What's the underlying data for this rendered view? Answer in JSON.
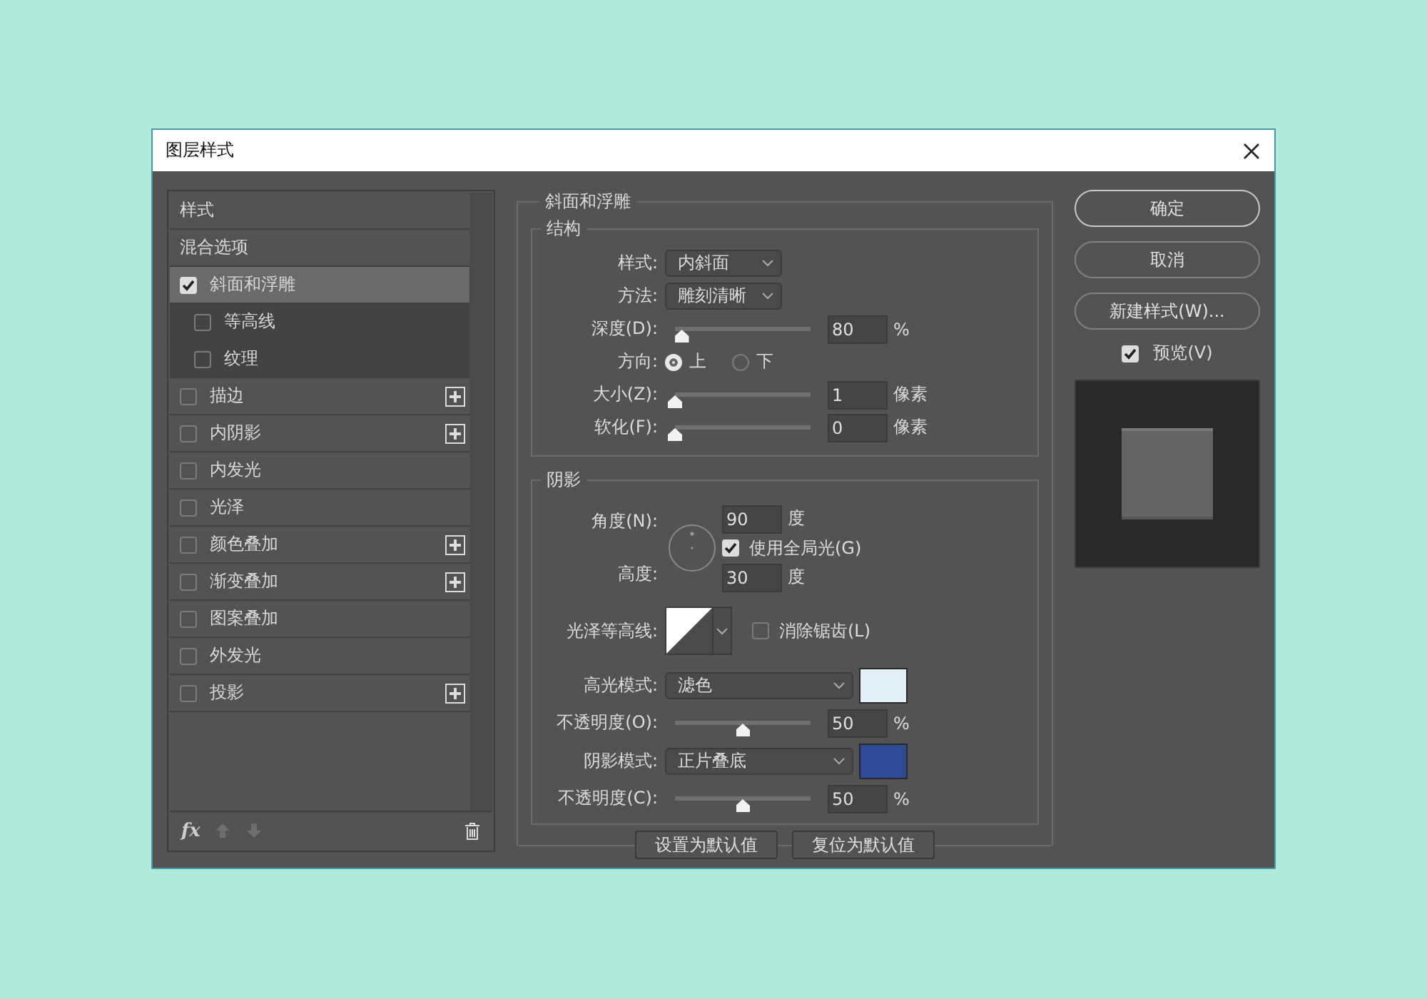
{
  "window": {
    "title": "图层样式"
  },
  "styles_list": [
    {
      "kind": "section",
      "label": "样式",
      "selected": false
    },
    {
      "kind": "section",
      "label": "混合选项",
      "selected": false
    },
    {
      "kind": "effect",
      "label": "斜面和浮雕",
      "checked": true,
      "selected": true,
      "addable": false,
      "children": [
        {
          "kind": "effect",
          "label": "等高线",
          "checked": false,
          "selected": false
        },
        {
          "kind": "effect",
          "label": "纹理",
          "checked": false,
          "selected": false
        }
      ]
    },
    {
      "kind": "effect",
      "label": "描边",
      "checked": false,
      "selected": false,
      "addable": true
    },
    {
      "kind": "effect",
      "label": "内阴影",
      "checked": false,
      "selected": false,
      "addable": true
    },
    {
      "kind": "effect",
      "label": "内发光",
      "checked": false,
      "selected": false,
      "addable": false
    },
    {
      "kind": "effect",
      "label": "光泽",
      "checked": false,
      "selected": false,
      "addable": false
    },
    {
      "kind": "effect",
      "label": "颜色叠加",
      "checked": false,
      "selected": false,
      "addable": true
    },
    {
      "kind": "effect",
      "label": "渐变叠加",
      "checked": false,
      "selected": false,
      "addable": true
    },
    {
      "kind": "effect",
      "label": "图案叠加",
      "checked": false,
      "selected": false,
      "addable": false
    },
    {
      "kind": "effect",
      "label": "外发光",
      "checked": false,
      "selected": false,
      "addable": false
    },
    {
      "kind": "effect",
      "label": "投影",
      "checked": false,
      "selected": false,
      "addable": true
    }
  ],
  "list_footer": {
    "effects_button": "fx"
  },
  "bevel": {
    "title": "斜面和浮雕",
    "structure": {
      "title": "结构",
      "style": {
        "label": "样式:",
        "value": "内斜面"
      },
      "technique": {
        "label": "方法:",
        "value": "雕刻清晰"
      },
      "depth": {
        "label": "深度(D):",
        "level": 0.05,
        "value": "80",
        "unit": "%"
      },
      "direction": {
        "label": "方向:",
        "options": [
          {
            "label": "上",
            "selected": true
          },
          {
            "label": "下",
            "selected": false
          }
        ]
      },
      "size": {
        "label": "大小(Z):",
        "level": 0,
        "value": "1",
        "unit": "像素"
      },
      "soften": {
        "label": "软化(F):",
        "level": 0,
        "value": "0",
        "unit": "像素"
      }
    },
    "shading": {
      "title": "阴影",
      "angle": {
        "label": "角度(N):",
        "value": "90",
        "unit": "度"
      },
      "global_light": {
        "label": "使用全局光(G)",
        "checked": true
      },
      "altitude": {
        "label": "高度:",
        "value": "30",
        "unit": "度"
      },
      "gloss_contour": {
        "label": "光泽等高线:"
      },
      "anti_alias": {
        "label": "消除锯齿(L)",
        "checked": false
      },
      "highlight_mode": {
        "label": "高光模式:",
        "value": "滤色",
        "color": "#e2f0f5"
      },
      "highlight_opacity": {
        "label": "不透明度(O):",
        "level": 0.5,
        "value": "50",
        "unit": "%"
      },
      "shadow_mode": {
        "label": "阴影模式:",
        "value": "正片叠底",
        "color": "#2d4a95"
      },
      "shadow_opacity": {
        "label": "不透明度(C):",
        "level": 0.5,
        "value": "50",
        "unit": "%"
      }
    },
    "buttons": [
      "设置为默认值",
      "复位为默认值"
    ]
  },
  "actions": {
    "ok": "确定",
    "cancel": "取消",
    "new_style": "新建样式(W)...",
    "preview": {
      "label": "预览(V)",
      "checked": true
    }
  }
}
